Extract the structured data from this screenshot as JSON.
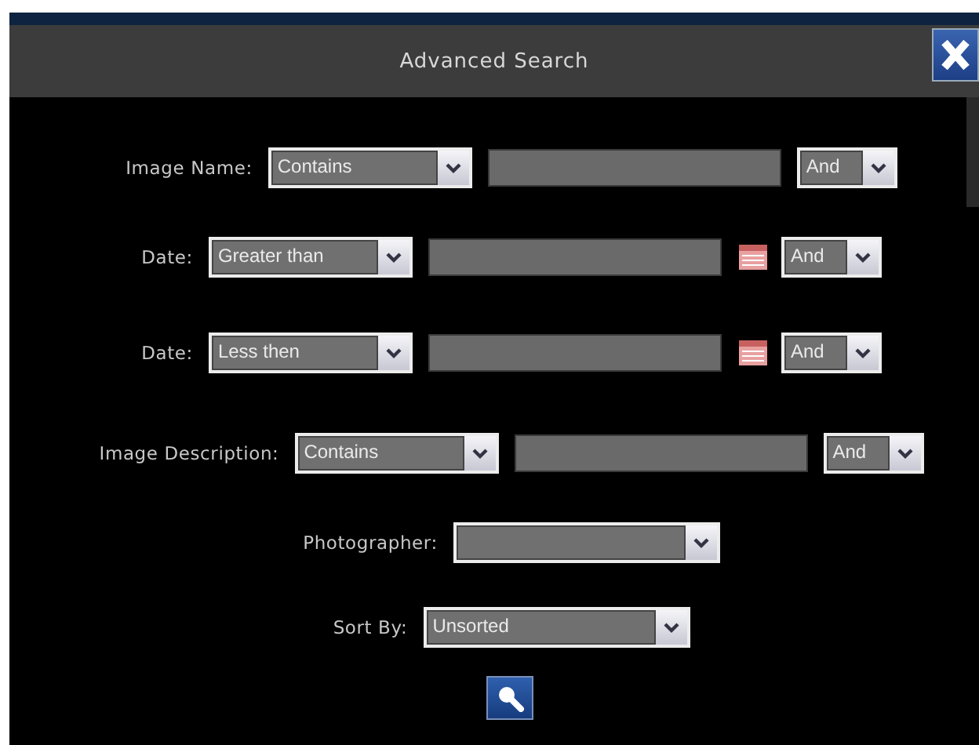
{
  "dialog": {
    "title": "Advanced Search"
  },
  "fields": [
    {
      "kind": "condition",
      "label": "Image Name:",
      "operator": "Contains",
      "calendar": false,
      "connector": "And"
    },
    {
      "kind": "condition",
      "label": "Date:",
      "operator": "Greater than",
      "calendar": true,
      "connector": "And"
    },
    {
      "kind": "condition",
      "label": "Date:",
      "operator": "Less then",
      "calendar": true,
      "connector": "And"
    },
    {
      "kind": "condition",
      "label": "Image Description:",
      "operator": "Contains",
      "calendar": false,
      "connector": "And"
    },
    {
      "kind": "select",
      "label": "Photographer:"
    },
    {
      "kind": "select",
      "label": "Sort By:",
      "value": "Unsorted"
    }
  ]
}
